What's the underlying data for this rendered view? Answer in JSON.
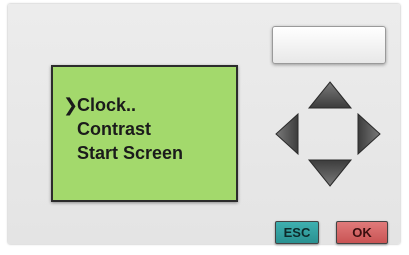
{
  "screen": {
    "cursor": "❯",
    "menu": [
      {
        "label": "Clock..",
        "selected": true
      },
      {
        "label": "Contrast",
        "selected": false
      },
      {
        "label": "Start Screen",
        "selected": false
      }
    ]
  },
  "keys": {
    "esc_label": "ESC",
    "ok_label": "OK"
  },
  "icons": {
    "up": "arrow-up-icon",
    "down": "arrow-down-icon",
    "left": "arrow-left-icon",
    "right": "arrow-right-icon"
  },
  "colors": {
    "lcd": "#a3d96c",
    "esc": "#2a9191",
    "ok": "#c95454",
    "arrow": "#4a4a4a"
  }
}
